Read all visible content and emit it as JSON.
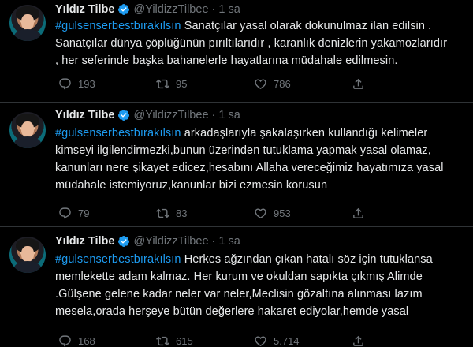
{
  "tweets": [
    {
      "name": "Yıldız Tilbe",
      "handle": "@YildizzTilbee",
      "separator": "·",
      "time": "1 sa",
      "lines": [
        {
          "hashtag": "#gulsenserbestbırakılsın",
          "text": " Sanatçılar yasal olarak dokunulmaz ilan edilsin ."
        },
        {
          "hashtag": "",
          "text": "Sanatçılar dünya çöplüğünün pırıltılarıdır , karanlık denizlerin yakamozlarıdır"
        },
        {
          "hashtag": "",
          "text": ", her seferinde başka bahanelerle hayatlarına müdahale edilmesin."
        }
      ],
      "stats": {
        "replies": "193",
        "retweets": "95",
        "likes": "786"
      }
    },
    {
      "name": "Yıldız Tilbe",
      "handle": "@YildizzTilbee",
      "separator": "·",
      "time": "1 sa",
      "lines": [
        {
          "hashtag": "#gulsenserbestbırakılsın",
          "text": " arkadaşlarıyla şakalaşırken kullandığı kelimeler"
        },
        {
          "hashtag": "",
          "text": "kimseyi ilgilendirmezki,bunun üzerinden tutuklama yapmak yasal olamaz,"
        },
        {
          "hashtag": "",
          "text": "kanunları nere şikayet edicez,hesabını Allaha vereceğimiz hayatımıza yasal"
        },
        {
          "hashtag": "",
          "text": "müdahale istemiyoruz,kanunlar bizi ezmesin korusun"
        }
      ],
      "stats": {
        "replies": "7​9",
        "retweets": "83",
        "likes": "953"
      }
    },
    {
      "name": "Yıldız Tilbe",
      "handle": "@YildizzTilbee",
      "separator": "·",
      "time": "1 sa",
      "lines": [
        {
          "hashtag": "#gulsenserbestbırakılsın",
          "text": " Herkes  ağzından çıkan hatalı söz için tutuklansa"
        },
        {
          "hashtag": "",
          "text": "memlekette adam kalmaz. Her kurum ve okuldan sapıkta çıkmış Alimde"
        },
        {
          "hashtag": "",
          "text": ".Gülşene gelene kadar neler var neler,Meclisin gözaltına alınması lazım"
        },
        {
          "hashtag": "",
          "text": "mesela,orada herşeye bütün değerlere hakaret ediyolar,hemde yasal"
        }
      ],
      "stats": {
        "replies": "168",
        "retweets": "615",
        "likes": "5.714"
      }
    }
  ],
  "colors": {
    "background": "#000000",
    "text": "#e7e9ea",
    "muted": "#71767b",
    "link": "#1d9bf0",
    "verified": "#1d9bf0",
    "divider": "#2f3336"
  },
  "icons": {
    "verified": "verified-badge-icon",
    "reply": "reply-icon",
    "retweet": "retweet-icon",
    "like": "heart-icon",
    "share": "share-icon"
  }
}
